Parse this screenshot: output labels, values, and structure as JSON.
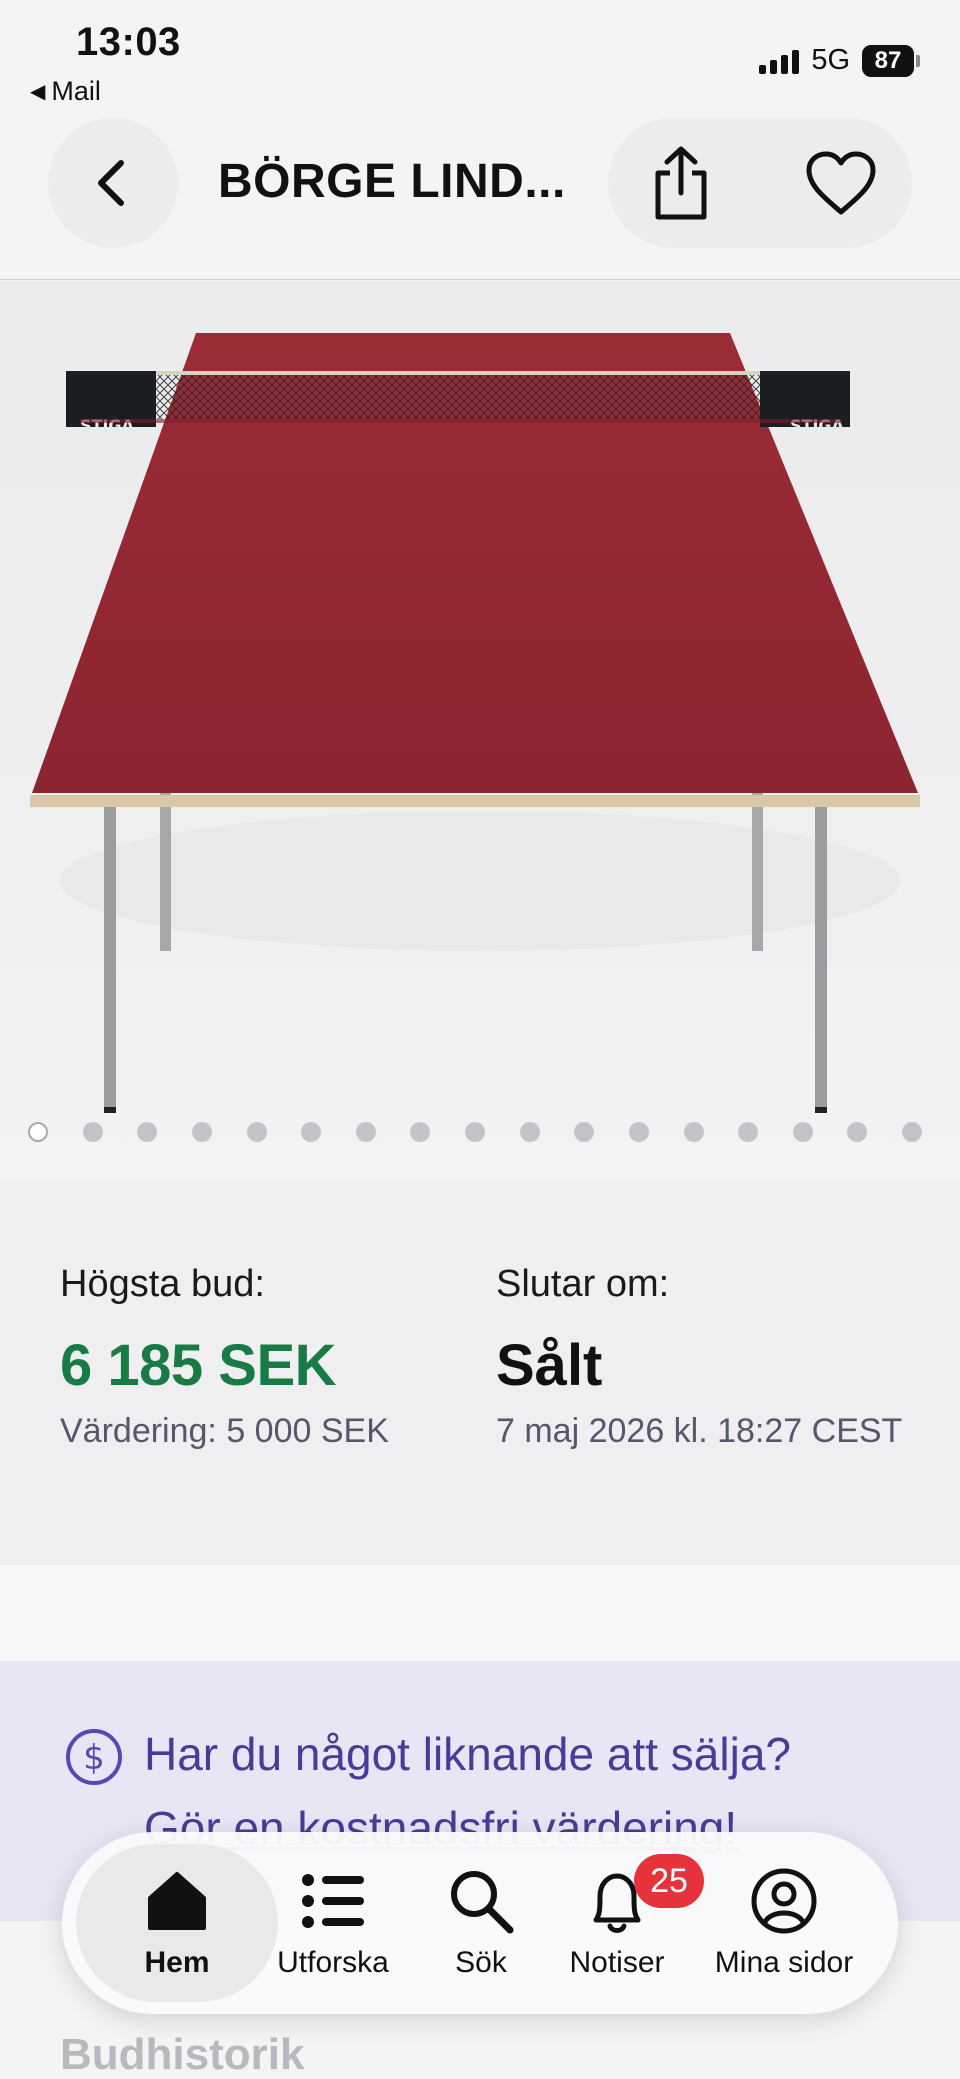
{
  "status": {
    "time": "13:03",
    "back_app_label": "Mail",
    "network": "5G",
    "battery": "87"
  },
  "header": {
    "title": "BÖRGE LIND...",
    "back_icon": "chevron-left-icon",
    "share_icon": "share-icon",
    "favorite_icon": "heart-outline-icon"
  },
  "gallery": {
    "image_count": 17,
    "active_index": 0,
    "net_brand": "STIGA",
    "table_color": "#8e2530"
  },
  "bid": {
    "highest_label": "Högsta bud:",
    "highest_value": "6 185 SEK",
    "valuation": "Värdering: 5 000 SEK",
    "ends_label": "Slutar om:",
    "ends_value": "Sålt",
    "ends_date": "7 maj 2026 kl. 18:27 CEST"
  },
  "promo": {
    "question": "Har du något liknande att sälja?",
    "link": "Gör en kostnadsfri värdering!",
    "icon": "dollar-circle-icon"
  },
  "history": {
    "title": "Budhistorik"
  },
  "tabbar": {
    "home": "Hem",
    "explore": "Utforska",
    "search": "Sök",
    "notifications": "Notiser",
    "notifications_badge": "25",
    "profile": "Mina sidor"
  },
  "colors": {
    "accent_green": "#187a44",
    "promo_purple": "#4a3b98",
    "badge_red": "#e5323b"
  }
}
